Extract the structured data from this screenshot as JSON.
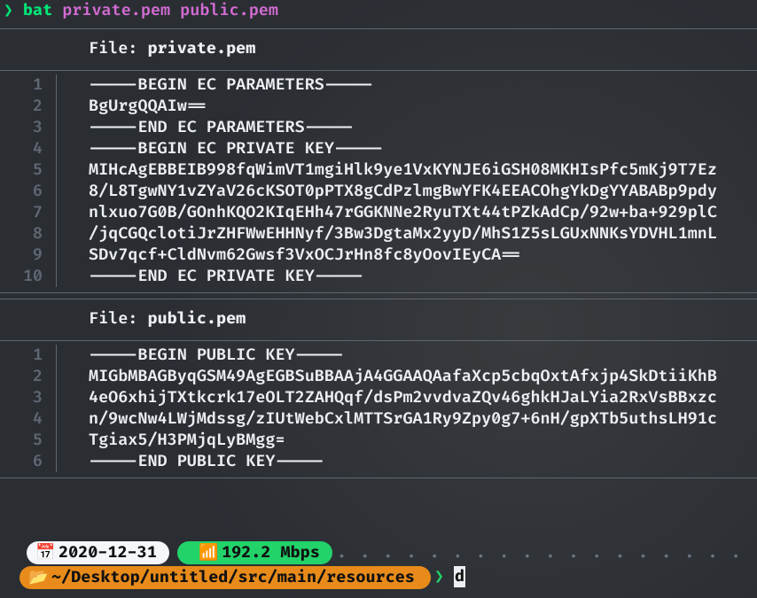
{
  "command": {
    "arrow": "❯",
    "name": "bat",
    "args": "private.pem public.pem"
  },
  "files": [
    {
      "header_label": "File:",
      "name": "private.pem",
      "lines": [
        "-----BEGIN EC PARAMETERS-----",
        "BgUrgQQAIw==",
        "-----END EC PARAMETERS-----",
        "-----BEGIN EC PRIVATE KEY-----",
        "MIHcAgEBBEIB998fqWimVT1mgiHlk9ye1VxKYNJE6iGSH08MKHIsPfc5mKj9T7Ez",
        "8/L8TgwNY1vZYaV26cKSOT0pPTX8gCdPzlmgBwYFK4EEACOhgYkDgYYABABp9pdy",
        "nlxuo7G0B/GOnhKQO2KIqEHh47rGGKNNe2RyuTXt44tPZkAdCp/92w+ba+929plC",
        "/jqCGQclotiJrZHFWwEHHNyf/3Bw3DgtaMx2yyD/MhS1Z5sLGUxNNKsYDVHL1mnL",
        "SDv7qcf+CldNvm62Gwsf3VxOCJrHn8fc8yOovIEyCA==",
        "-----END EC PRIVATE KEY-----"
      ]
    },
    {
      "header_label": "File:",
      "name": "public.pem",
      "lines": [
        "-----BEGIN PUBLIC KEY-----",
        "MIGbMBAGByqGSM49AgEGBSuBBAAjA4GGAAQAafaXcp5cbqOxtAfxjp4SkDtiiKhB",
        "4eO6xhijTXtkcrk17eOLT2ZAHQqf/dsPm2vvdvaZQv46ghkHJaLYia2RxVsBBxzc",
        "n/9wcNw4LWjMdssg/zIUtWebCxlMTTSrGA1Ry9Zpy0g7+6nH/gpXTb5uthsLH91c",
        "Tgiax5/H3PMjqLyBMgg=",
        "-----END PUBLIC KEY-----"
      ]
    }
  ],
  "status": {
    "date_icon": "📅",
    "date": "2020-12-31",
    "net_icon": "📶",
    "net": "192.2 Mbps",
    "folder_icon": "📂",
    "path": "~/Desktop/untitled/src/main/resources",
    "prompt": "❯",
    "typed": "d",
    "dots": "· · · · · · · · · · · · · · · · · · · · · · · · · · · · · · · · · · · · · · · · ·"
  }
}
